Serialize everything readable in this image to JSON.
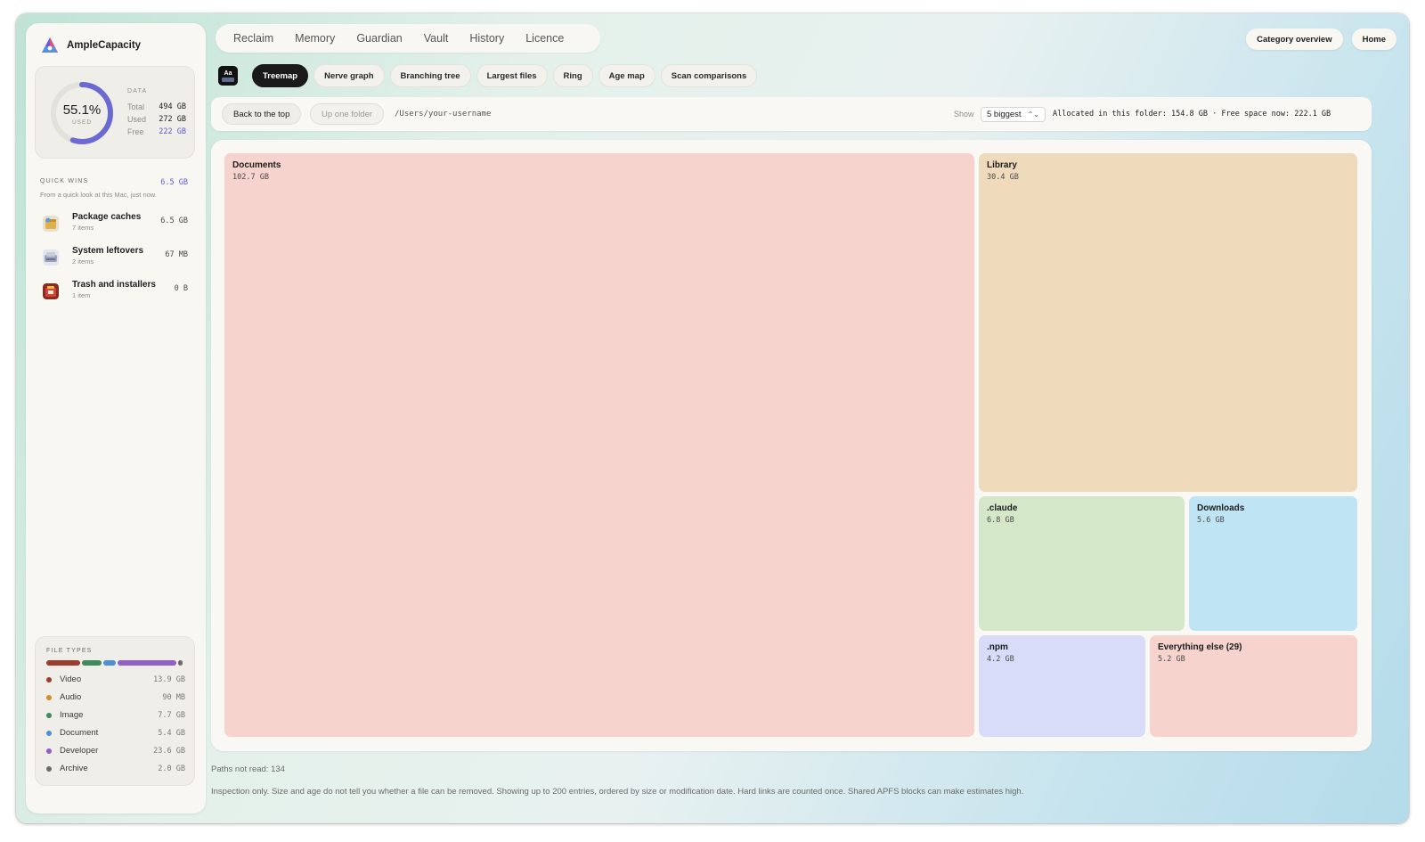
{
  "app": {
    "name": "AmpleCapacity"
  },
  "disk": {
    "percent": "55.1%",
    "percent_value": 0.551,
    "used_caption": "USED",
    "data_title": "DATA",
    "rows": [
      {
        "label": "Total",
        "value": "494 GB"
      },
      {
        "label": "Used",
        "value": "272 GB"
      },
      {
        "label": "Free",
        "value": "222 GB"
      }
    ]
  },
  "quick_wins": {
    "title": "QUICK WINS",
    "total": "6.5 GB",
    "subtitle": "From a quick look at this Mac, just now.",
    "items": [
      {
        "name": "Package caches",
        "count": "7 items",
        "size": "6.5 GB",
        "icon": "package-icon"
      },
      {
        "name": "System leftovers",
        "count": "2 items",
        "size": "67 MB",
        "icon": "system-icon"
      },
      {
        "name": "Trash and installers",
        "count": "1 item",
        "size": "0 B",
        "icon": "trash-icon"
      }
    ]
  },
  "file_types": {
    "title": "FILE TYPES",
    "items": [
      {
        "name": "Video",
        "size": "13.9 GB",
        "color": "#9c3b2e"
      },
      {
        "name": "Audio",
        "size": "90 MB",
        "color": "#d48a2c"
      },
      {
        "name": "Image",
        "size": "7.7 GB",
        "color": "#3f8a5a"
      },
      {
        "name": "Document",
        "size": "5.4 GB",
        "color": "#4f8fd6"
      },
      {
        "name": "Developer",
        "size": "23.6 GB",
        "color": "#9160c7"
      },
      {
        "name": "Archive",
        "size": "2.0 GB",
        "color": "#6b6b6b"
      }
    ]
  },
  "nav": {
    "tabs": [
      "Reclaim",
      "Memory",
      "Guardian",
      "Vault",
      "History",
      "Licence"
    ],
    "category_overview": "Category overview",
    "home": "Home"
  },
  "views": {
    "tabs": [
      "Treemap",
      "Nerve graph",
      "Branching tree",
      "Largest files",
      "Ring",
      "Age map",
      "Scan comparisons"
    ],
    "active": "Treemap"
  },
  "pathbar": {
    "back": "Back to the top",
    "up": "Up one folder",
    "path": "/Users/your-username",
    "show_label": "Show",
    "show_value": "5 biggest",
    "allocated": "Allocated in this folder: 154.8 GB · Free space now: 222.1 GB"
  },
  "treemap": {
    "tiles": [
      {
        "name": "Documents",
        "size": "102.7 GB",
        "color": "#f6d3cc"
      },
      {
        "name": "Library",
        "size": "30.4 GB",
        "color": "#f0dabc"
      },
      {
        "name": ".claude",
        "size": "6.8 GB",
        "color": "#d4e7c8"
      },
      {
        "name": "Downloads",
        "size": "5.6 GB",
        "color": "#bfe4f4"
      },
      {
        "name": ".npm",
        "size": "4.2 GB",
        "color": "#d9dcf8"
      },
      {
        "name": "Everything else (29)",
        "size": "5.2 GB",
        "color": "#f6d3cc"
      }
    ]
  },
  "footer": {
    "paths_not_read": "Paths not read: 134",
    "disclaimer": "Inspection only. Size and age do not tell you whether a file can be removed. Showing up to 200 entries, ordered by size or modification date. Hard links are counted once. Shared APFS blocks can make estimates high."
  }
}
